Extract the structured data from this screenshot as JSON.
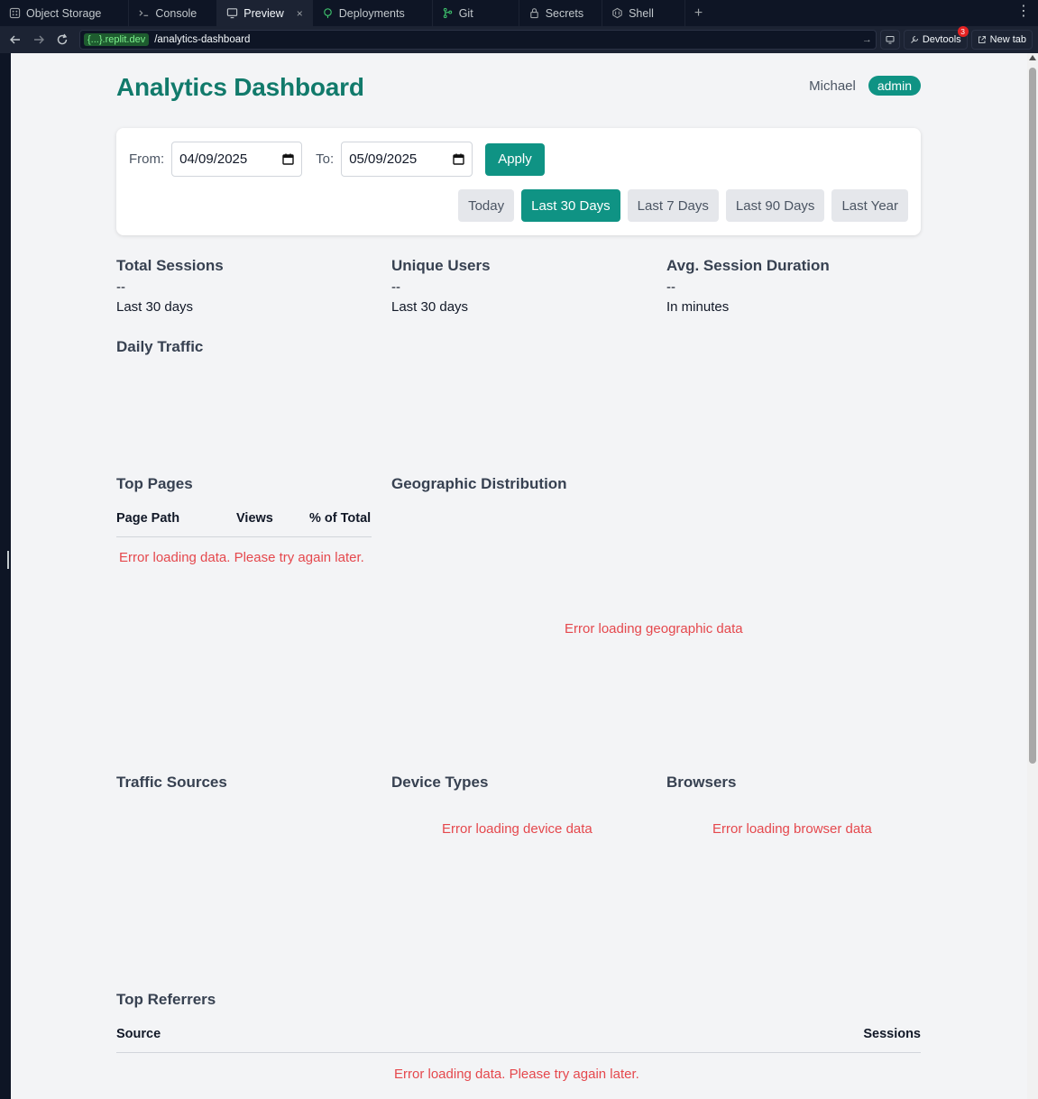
{
  "chrome": {
    "tabs": [
      {
        "label": "Object Storage",
        "icon": "object-storage-icon"
      },
      {
        "label": "Console",
        "icon": "console-icon"
      },
      {
        "label": "Preview",
        "icon": "preview-icon",
        "active": true
      },
      {
        "label": "Deployments",
        "icon": "deployments-icon"
      },
      {
        "label": "Git",
        "icon": "git-icon"
      },
      {
        "label": "Secrets",
        "icon": "lock-icon"
      },
      {
        "label": "Shell",
        "icon": "shell-icon"
      }
    ],
    "close_glyph": "×",
    "add_glyph": "+",
    "menu_glyph": "⋮",
    "url_domain": "{...}.replit.dev",
    "url_path": "/analytics-dashboard",
    "devtools_label": "Devtools",
    "devtools_badge": "3",
    "newtab_label": "New tab"
  },
  "header": {
    "title": "Analytics Dashboard",
    "username": "Michael",
    "role": "admin"
  },
  "filters": {
    "from_label": "From:",
    "from_value": "04/09/2025",
    "to_label": "To:",
    "to_value": "05/09/2025",
    "apply_label": "Apply",
    "presets": [
      "Today",
      "Last 30 Days",
      "Last 7 Days",
      "Last 90 Days",
      "Last Year"
    ],
    "active_preset": "Last 30 Days"
  },
  "stats": [
    {
      "title": "Total Sessions",
      "value": "--",
      "sub": "Last 30 days"
    },
    {
      "title": "Unique Users",
      "value": "--",
      "sub": "Last 30 days"
    },
    {
      "title": "Avg. Session Duration",
      "value": "--",
      "sub": "In minutes"
    }
  ],
  "daily_traffic": {
    "title": "Daily Traffic"
  },
  "top_pages": {
    "title": "Top Pages",
    "columns": [
      "Page Path",
      "Views",
      "% of Total"
    ],
    "error": "Error loading data. Please try again later."
  },
  "geo": {
    "title": "Geographic Distribution",
    "error": "Error loading geographic data"
  },
  "traffic_sources": {
    "title": "Traffic Sources"
  },
  "device_types": {
    "title": "Device Types",
    "error": "Error loading device data"
  },
  "browsers": {
    "title": "Browsers",
    "error": "Error loading browser data"
  },
  "top_referrers": {
    "title": "Top Referrers",
    "columns": [
      "Source",
      "Sessions"
    ],
    "error": "Error loading data. Please try again later."
  },
  "colors": {
    "accent": "#0f9384",
    "title": "#117a6b",
    "error": "#e5484d"
  }
}
